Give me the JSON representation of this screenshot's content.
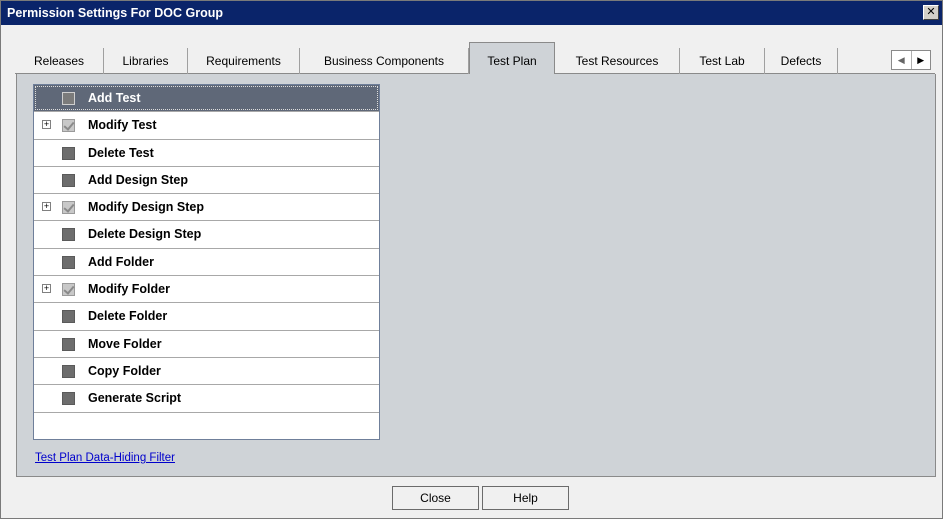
{
  "window": {
    "title": "Permission Settings For DOC Group",
    "close_glyph": "✕"
  },
  "tabs": [
    {
      "label": "Releases",
      "active": false
    },
    {
      "label": "Libraries",
      "active": false
    },
    {
      "label": "Requirements",
      "active": false
    },
    {
      "label": "Business Components",
      "active": false
    },
    {
      "label": "Test Plan",
      "active": true
    },
    {
      "label": "Test Resources",
      "active": false
    },
    {
      "label": "Test Lab",
      "active": false
    },
    {
      "label": "Defects",
      "active": false
    }
  ],
  "tab_scroll": {
    "left_glyph": "◀",
    "right_glyph": "▶"
  },
  "permissions": [
    {
      "label": "Add Test",
      "checked": false,
      "expandable": false,
      "selected": true
    },
    {
      "label": "Modify Test",
      "checked": true,
      "expandable": true,
      "selected": false
    },
    {
      "label": "Delete Test",
      "checked": false,
      "expandable": false,
      "selected": false
    },
    {
      "label": "Add Design Step",
      "checked": false,
      "expandable": false,
      "selected": false
    },
    {
      "label": "Modify Design Step",
      "checked": true,
      "expandable": true,
      "selected": false
    },
    {
      "label": "Delete Design Step",
      "checked": false,
      "expandable": false,
      "selected": false
    },
    {
      "label": "Add Folder",
      "checked": false,
      "expandable": false,
      "selected": false
    },
    {
      "label": "Modify Folder",
      "checked": true,
      "expandable": true,
      "selected": false
    },
    {
      "label": "Delete Folder",
      "checked": false,
      "expandable": false,
      "selected": false
    },
    {
      "label": "Move Folder",
      "checked": false,
      "expandable": false,
      "selected": false
    },
    {
      "label": "Copy Folder",
      "checked": false,
      "expandable": false,
      "selected": false
    },
    {
      "label": "Generate Script",
      "checked": false,
      "expandable": false,
      "selected": false
    }
  ],
  "expander_glyph": "+",
  "filter_link": "Test Plan Data-Hiding Filter",
  "buttons": {
    "close": "Close",
    "help": "Help"
  },
  "colors": {
    "titlebar": "#0a246a",
    "panel": "#cfd3d7",
    "selected_row": "#5f6878",
    "link": "#0000cc"
  }
}
